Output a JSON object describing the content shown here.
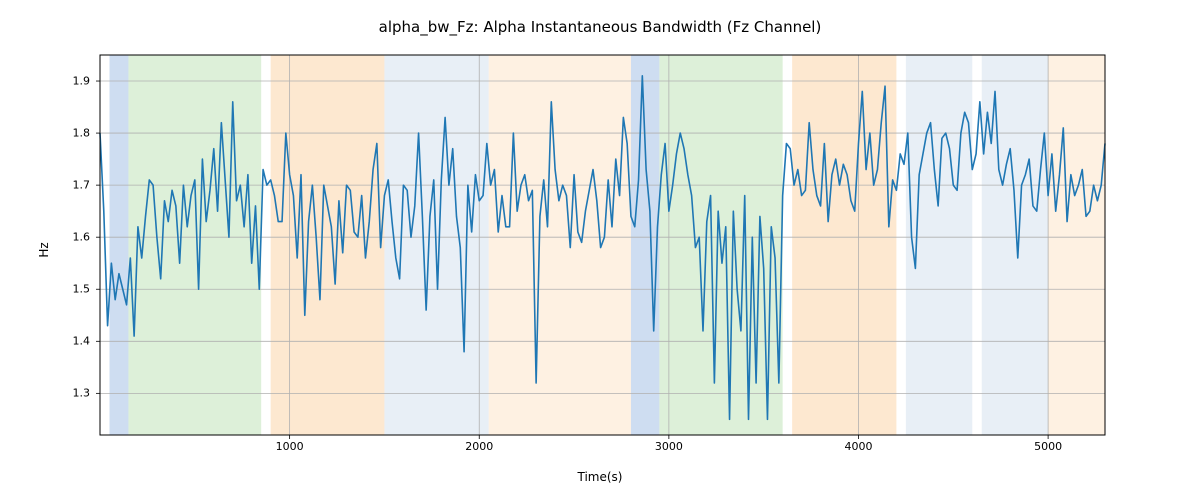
{
  "chart_data": {
    "type": "line",
    "title": "alpha_bw_Fz: Alpha Instantaneous Bandwidth (Fz Channel)",
    "xlabel": "Time(s)",
    "ylabel": "Hz",
    "xlim": [
      0,
      5300
    ],
    "ylim": [
      1.22,
      1.95
    ],
    "xticks": [
      1000,
      2000,
      3000,
      4000,
      5000
    ],
    "yticks": [
      1.3,
      1.4,
      1.5,
      1.6,
      1.7,
      1.8,
      1.9
    ],
    "bands": [
      {
        "x0": 50,
        "x1": 150,
        "color": "#aec7e8"
      },
      {
        "x0": 150,
        "x1": 850,
        "color": "#c7e6c0"
      },
      {
        "x0": 900,
        "x1": 1500,
        "color": "#fcd9b0"
      },
      {
        "x0": 1500,
        "x1": 2050,
        "color": "#d8e4f0"
      },
      {
        "x0": 2050,
        "x1": 2800,
        "color": "#fde8cf"
      },
      {
        "x0": 2800,
        "x1": 2950,
        "color": "#aec7e8"
      },
      {
        "x0": 2950,
        "x1": 3600,
        "color": "#c7e6c0"
      },
      {
        "x0": 3650,
        "x1": 4200,
        "color": "#fcd9b0"
      },
      {
        "x0": 4250,
        "x1": 4600,
        "color": "#d8e4f0"
      },
      {
        "x0": 4650,
        "x1": 5000,
        "color": "#d8e4f0"
      },
      {
        "x0": 5000,
        "x1": 5300,
        "color": "#fde8cf"
      }
    ],
    "series": [
      {
        "name": "alpha_bw_Fz",
        "color": "#1f77b4",
        "x_step": 20,
        "values": [
          1.8,
          1.65,
          1.43,
          1.55,
          1.48,
          1.53,
          1.5,
          1.47,
          1.56,
          1.41,
          1.62,
          1.56,
          1.64,
          1.71,
          1.7,
          1.6,
          1.52,
          1.67,
          1.63,
          1.69,
          1.66,
          1.55,
          1.7,
          1.62,
          1.68,
          1.71,
          1.5,
          1.75,
          1.63,
          1.69,
          1.77,
          1.65,
          1.82,
          1.71,
          1.6,
          1.86,
          1.67,
          1.7,
          1.62,
          1.72,
          1.55,
          1.66,
          1.5,
          1.73,
          1.7,
          1.71,
          1.68,
          1.63,
          1.63,
          1.8,
          1.72,
          1.68,
          1.56,
          1.72,
          1.45,
          1.63,
          1.7,
          1.6,
          1.48,
          1.7,
          1.66,
          1.62,
          1.51,
          1.67,
          1.57,
          1.7,
          1.69,
          1.61,
          1.6,
          1.68,
          1.56,
          1.63,
          1.73,
          1.78,
          1.58,
          1.68,
          1.71,
          1.63,
          1.56,
          1.52,
          1.7,
          1.69,
          1.6,
          1.66,
          1.8,
          1.64,
          1.46,
          1.64,
          1.71,
          1.5,
          1.71,
          1.83,
          1.7,
          1.77,
          1.64,
          1.58,
          1.38,
          1.7,
          1.61,
          1.72,
          1.67,
          1.68,
          1.78,
          1.7,
          1.73,
          1.61,
          1.68,
          1.62,
          1.62,
          1.8,
          1.65,
          1.7,
          1.72,
          1.67,
          1.69,
          1.32,
          1.64,
          1.71,
          1.62,
          1.86,
          1.73,
          1.67,
          1.7,
          1.68,
          1.58,
          1.72,
          1.61,
          1.59,
          1.65,
          1.69,
          1.73,
          1.67,
          1.58,
          1.6,
          1.71,
          1.62,
          1.75,
          1.68,
          1.83,
          1.78,
          1.64,
          1.62,
          1.71,
          1.91,
          1.73,
          1.65,
          1.42,
          1.62,
          1.72,
          1.78,
          1.65,
          1.7,
          1.76,
          1.8,
          1.77,
          1.72,
          1.68,
          1.58,
          1.6,
          1.42,
          1.63,
          1.68,
          1.32,
          1.65,
          1.55,
          1.62,
          1.25,
          1.65,
          1.5,
          1.42,
          1.68,
          1.25,
          1.6,
          1.32,
          1.64,
          1.54,
          1.25,
          1.62,
          1.56,
          1.32,
          1.68,
          1.78,
          1.77,
          1.7,
          1.73,
          1.68,
          1.69,
          1.82,
          1.73,
          1.68,
          1.66,
          1.78,
          1.63,
          1.72,
          1.75,
          1.7,
          1.74,
          1.72,
          1.67,
          1.65,
          1.78,
          1.88,
          1.73,
          1.8,
          1.7,
          1.73,
          1.82,
          1.89,
          1.62,
          1.71,
          1.69,
          1.76,
          1.74,
          1.8,
          1.6,
          1.54,
          1.72,
          1.76,
          1.8,
          1.82,
          1.73,
          1.66,
          1.79,
          1.8,
          1.77,
          1.7,
          1.69,
          1.8,
          1.84,
          1.82,
          1.73,
          1.76,
          1.86,
          1.76,
          1.84,
          1.78,
          1.88,
          1.73,
          1.7,
          1.74,
          1.77,
          1.69,
          1.56,
          1.7,
          1.72,
          1.75,
          1.66,
          1.65,
          1.73,
          1.8,
          1.68,
          1.76,
          1.65,
          1.72,
          1.81,
          1.63,
          1.72,
          1.68,
          1.7,
          1.73,
          1.64,
          1.65,
          1.7,
          1.67,
          1.7,
          1.78
        ]
      }
    ]
  }
}
